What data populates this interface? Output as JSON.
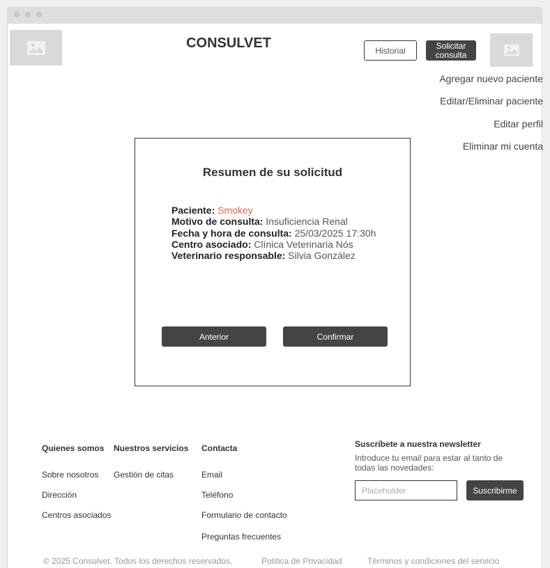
{
  "header": {
    "brand": "CONSULVET",
    "historial_label": "Historial",
    "solicitar_label_line1": "Solicitar",
    "solicitar_label_line2": "consulta"
  },
  "user_menu": {
    "items": [
      "Agregar nuevo paciente",
      "Editar/Eliminar paciente",
      "Editar perfil",
      "Eliminar mi cuenta"
    ]
  },
  "summary": {
    "title": "Resumen de su solicitud",
    "rows": [
      {
        "label": "Paciente:",
        "value": "Smokey"
      },
      {
        "label": "Motivo de consulta:",
        "value": "Insuficiencia Renal"
      },
      {
        "label": "Fecha y hora de consulta:",
        "value": "25/03/2025 17:30h"
      },
      {
        "label": "Centro asociado:",
        "value": "Clínica Veterinaria Nós"
      },
      {
        "label": "Veterinario responsable:",
        "value": "Silvia González"
      }
    ],
    "back_label": "Anterior",
    "confirm_label": "Confirmar"
  },
  "footer": {
    "columns": [
      {
        "heading": "Quienes somos",
        "links": [
          "Sobre nosotros",
          "Dirección",
          "Centros asociados"
        ]
      },
      {
        "heading": "Nuestros servicios",
        "links": [
          "Gestión de citas"
        ]
      },
      {
        "heading": "Contacta",
        "links": [
          "Email",
          "Teléfono",
          "Formulario de contacto",
          "Preguntas frecuentes"
        ]
      }
    ],
    "newsletter": {
      "heading": "Suscríbete a nuestra newsletter",
      "description": "Introduce tu email para estar al tanto de todas las novedades:",
      "placeholder": "Placeholder",
      "button_label": "Suscribirme"
    },
    "copyright": "© 2025 Consulvet. Todos los derechos reservados.",
    "privacy": "Política de Privacidad",
    "terms": "Términos y condiciones del servicio"
  },
  "colors": {
    "accent": "#e8644a",
    "dark_button": "#444444"
  },
  "icons": [
    "image-placeholder-icon"
  ]
}
